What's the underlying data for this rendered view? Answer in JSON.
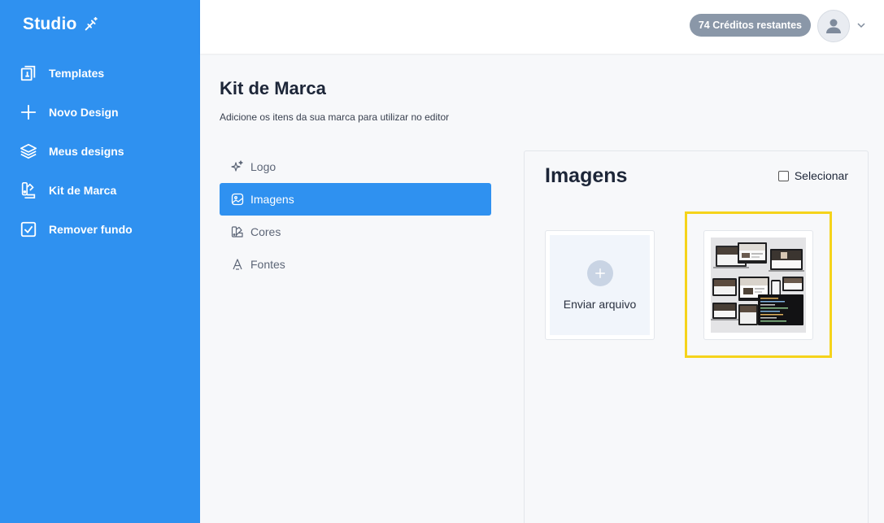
{
  "sidebar": {
    "brand": "Studio",
    "items": [
      {
        "label": "Templates",
        "icon": "templates-icon"
      },
      {
        "label": "Novo Design",
        "icon": "plus-icon"
      },
      {
        "label": "Meus designs",
        "icon": "layers-icon"
      },
      {
        "label": "Kit de Marca",
        "icon": "brand-kit-icon"
      },
      {
        "label": "Remover fundo",
        "icon": "checkbox-icon"
      }
    ]
  },
  "header": {
    "credits": "74 Créditos restantes"
  },
  "page": {
    "title": "Kit de Marca",
    "subtitle": "Adicione os itens da sua marca para utilizar no editor"
  },
  "subnav": {
    "items": [
      {
        "label": "Logo",
        "icon": "sparkle-icon",
        "active": false
      },
      {
        "label": "Imagens",
        "icon": "image-icon",
        "active": true
      },
      {
        "label": "Cores",
        "icon": "palette-icon",
        "active": false
      },
      {
        "label": "Fontes",
        "icon": "font-icon",
        "active": false
      }
    ]
  },
  "panel": {
    "title": "Imagens",
    "select_label": "Selecionar",
    "upload_label": "Enviar arquivo"
  },
  "colors": {
    "sidebar": "#2f91f0",
    "highlight": "#f5d31a",
    "credits_badge": "#8a97a8"
  }
}
